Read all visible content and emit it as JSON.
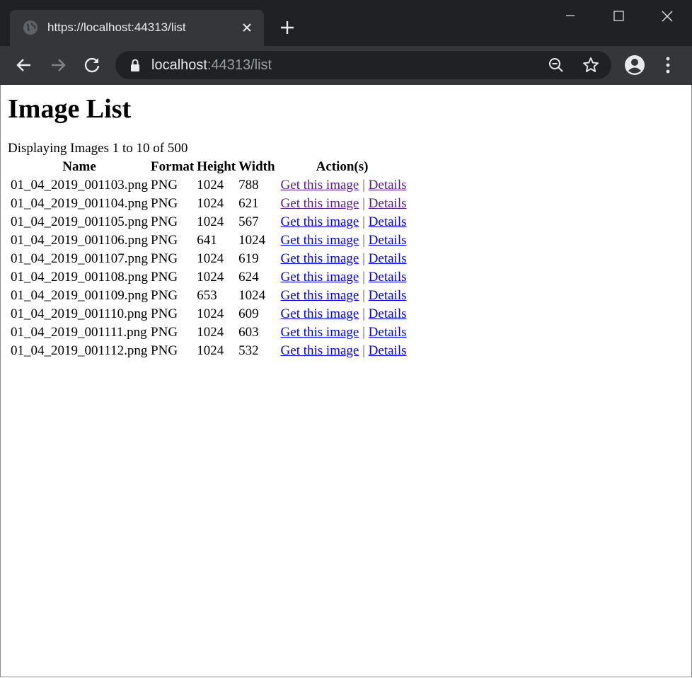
{
  "browser": {
    "tab_title": "https://localhost:44313/list",
    "url_host": "localhost",
    "url_rest": ":44313/list"
  },
  "page": {
    "heading": "Image List",
    "count_text": "Displaying Images 1 to 10 of 500",
    "columns": [
      "Name",
      "Format",
      "Height",
      "Width",
      "Action(s)"
    ],
    "get_label": "Get this image",
    "separator": "|",
    "details_label": "Details",
    "rows": [
      {
        "name": "01_04_2019_001103.png",
        "format": "PNG",
        "height": "1024",
        "width": "788",
        "visited": true
      },
      {
        "name": "01_04_2019_001104.png",
        "format": "PNG",
        "height": "1024",
        "width": "621",
        "visited": true
      },
      {
        "name": "01_04_2019_001105.png",
        "format": "PNG",
        "height": "1024",
        "width": "567",
        "visited": false
      },
      {
        "name": "01_04_2019_001106.png",
        "format": "PNG",
        "height": "641",
        "width": "1024",
        "visited": false
      },
      {
        "name": "01_04_2019_001107.png",
        "format": "PNG",
        "height": "1024",
        "width": "619",
        "visited": false
      },
      {
        "name": "01_04_2019_001108.png",
        "format": "PNG",
        "height": "1024",
        "width": "624",
        "visited": false
      },
      {
        "name": "01_04_2019_001109.png",
        "format": "PNG",
        "height": "653",
        "width": "1024",
        "visited": false
      },
      {
        "name": "01_04_2019_001110.png",
        "format": "PNG",
        "height": "1024",
        "width": "609",
        "visited": false
      },
      {
        "name": "01_04_2019_001111.png",
        "format": "PNG",
        "height": "1024",
        "width": "603",
        "visited": false
      },
      {
        "name": "01_04_2019_001112.png",
        "format": "PNG",
        "height": "1024",
        "width": "532",
        "visited": false
      }
    ]
  },
  "colors": {
    "chrome_bg": "#202124",
    "toolbar_bg": "#35363a",
    "link": "#0000ee",
    "link_visited": "#551a8b"
  },
  "icons": [
    "globe-icon",
    "close-icon",
    "plus-icon",
    "minimize-icon",
    "maximize-icon",
    "window-close-icon",
    "back-arrow-icon",
    "forward-arrow-icon",
    "reload-icon",
    "lock-icon",
    "zoom-out-icon",
    "star-icon",
    "account-icon",
    "kebab-menu-icon"
  ]
}
